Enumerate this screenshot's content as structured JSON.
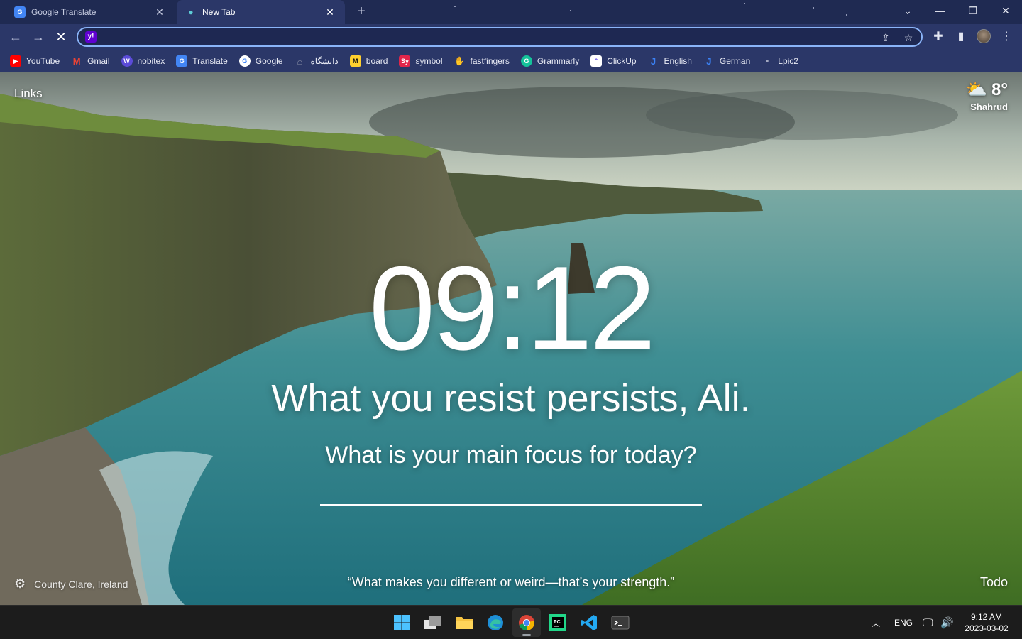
{
  "browser": {
    "tabs": [
      {
        "title": "Google Translate",
        "active": false,
        "favicon": "google-translate-icon"
      },
      {
        "title": "New Tab",
        "active": true,
        "favicon": "momentum-icon"
      }
    ],
    "address": {
      "value": "",
      "search_engine_icon": "yahoo-icon"
    },
    "bookmarks": [
      {
        "label": "YouTube",
        "icon": "youtube-icon",
        "color": "#ff0000"
      },
      {
        "label": "Gmail",
        "icon": "gmail-icon",
        "color": "#ea4335"
      },
      {
        "label": "nobitex",
        "icon": "nobitex-icon",
        "color": "#5b4bd8"
      },
      {
        "label": "Translate",
        "icon": "google-translate-icon",
        "color": "#4285f4"
      },
      {
        "label": "Google",
        "icon": "google-icon",
        "color": "#ffffff"
      },
      {
        "label": "دانشگاه",
        "icon": "university-icon",
        "color": "#8a8fa6"
      },
      {
        "label": "board",
        "icon": "miro-icon",
        "color": "#ffd02f"
      },
      {
        "label": "symbol",
        "icon": "symbol-icon",
        "color": "#e1254a"
      },
      {
        "label": "fastfingers",
        "icon": "fastfingers-icon",
        "color": "#f3c623"
      },
      {
        "label": "Grammarly",
        "icon": "grammarly-icon",
        "color": "#15c39a"
      },
      {
        "label": "ClickUp",
        "icon": "clickup-icon",
        "color": "#7b68ee"
      },
      {
        "label": "English",
        "icon": "english-icon",
        "color": "#3b82f6"
      },
      {
        "label": "German",
        "icon": "german-icon",
        "color": "#3b82f6"
      },
      {
        "label": "Lpic2",
        "icon": "lpic-icon",
        "color": "#a3a8c0"
      }
    ]
  },
  "momentum": {
    "links_label": "Links",
    "weather": {
      "temp": "8°",
      "location": "Shahrud",
      "icon": "partly-cloudy-icon"
    },
    "time": "09:12",
    "greeting": "What you resist persists, Ali.",
    "focus_question": "What is your main focus for today?",
    "photo_location": "County Clare, Ireland",
    "quote": "“What makes you different or weird—that’s your strength.”",
    "todo_label": "Todo"
  },
  "taskbar": {
    "apps": [
      "start-icon",
      "task-view-icon",
      "file-explorer-icon",
      "edge-icon",
      "chrome-icon",
      "pycharm-icon",
      "vscode-icon",
      "terminal-icon"
    ],
    "language": "ENG",
    "time": "9:12 AM",
    "date": "2023-03-02"
  }
}
